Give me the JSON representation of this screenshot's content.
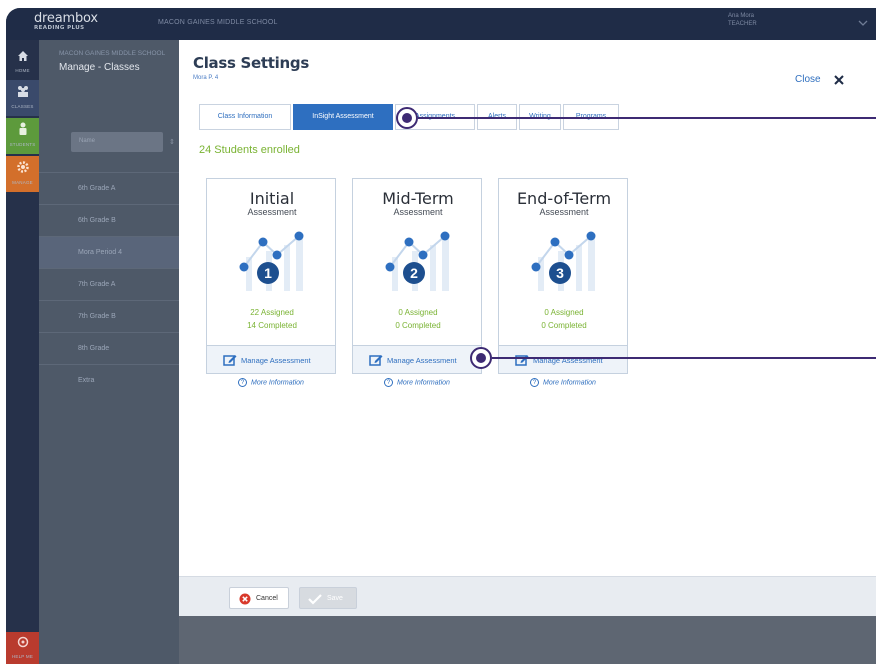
{
  "topbar": {
    "logo_main": "dreambox",
    "logo_sub": "READING PLUS",
    "school": "MACON GAINES MIDDLE SCHOOL",
    "user_name": "Ana Mora",
    "user_role": "TEACHER"
  },
  "nav": {
    "home": "HOME",
    "classes": "CLASSES",
    "students": "STUDENTS",
    "manage": "MANAGE",
    "help": "HELP ME"
  },
  "manage_panel": {
    "school": "MACON GAINES MIDDLE SCHOOL",
    "title": "Manage - Classes",
    "name_placeholder": "Name",
    "classes": [
      "6th Grade A",
      "6th Grade B",
      "Mora Period 4",
      "7th Grade A",
      "7th Grade B",
      "8th Grade",
      "Extra"
    ]
  },
  "modal": {
    "title": "Class Settings",
    "subtitle": "Mora P. 4",
    "close_label": "Close",
    "tabs": [
      "Class Information",
      "InSight Assessment",
      "Assignments",
      "Alerts",
      "Writing",
      "Programs"
    ],
    "enrolled": "24 Students enrolled",
    "cards": [
      {
        "title": "Initial",
        "subtitle": "Assessment",
        "number": "1",
        "assigned": "22 Assigned",
        "completed": "14 Completed",
        "manage": "Manage Assessment",
        "more": "More Information"
      },
      {
        "title": "Mid-Term",
        "subtitle": "Assessment",
        "number": "2",
        "assigned": "0 Assigned",
        "completed": "0 Completed",
        "manage": "Manage Assessment",
        "more": "More Information"
      },
      {
        "title": "End-of-Term",
        "subtitle": "Assessment",
        "number": "3",
        "assigned": "0 Assigned",
        "completed": "0 Completed",
        "manage": "Manage Assessment",
        "more": "More Information"
      }
    ],
    "cancel_label": "Cancel",
    "save_label": "Save"
  },
  "colors": {
    "accent_blue": "#2e6fc0",
    "enrolled_green": "#7ab333",
    "topbar": "#1f2c47",
    "callout": "#3d2a73"
  }
}
